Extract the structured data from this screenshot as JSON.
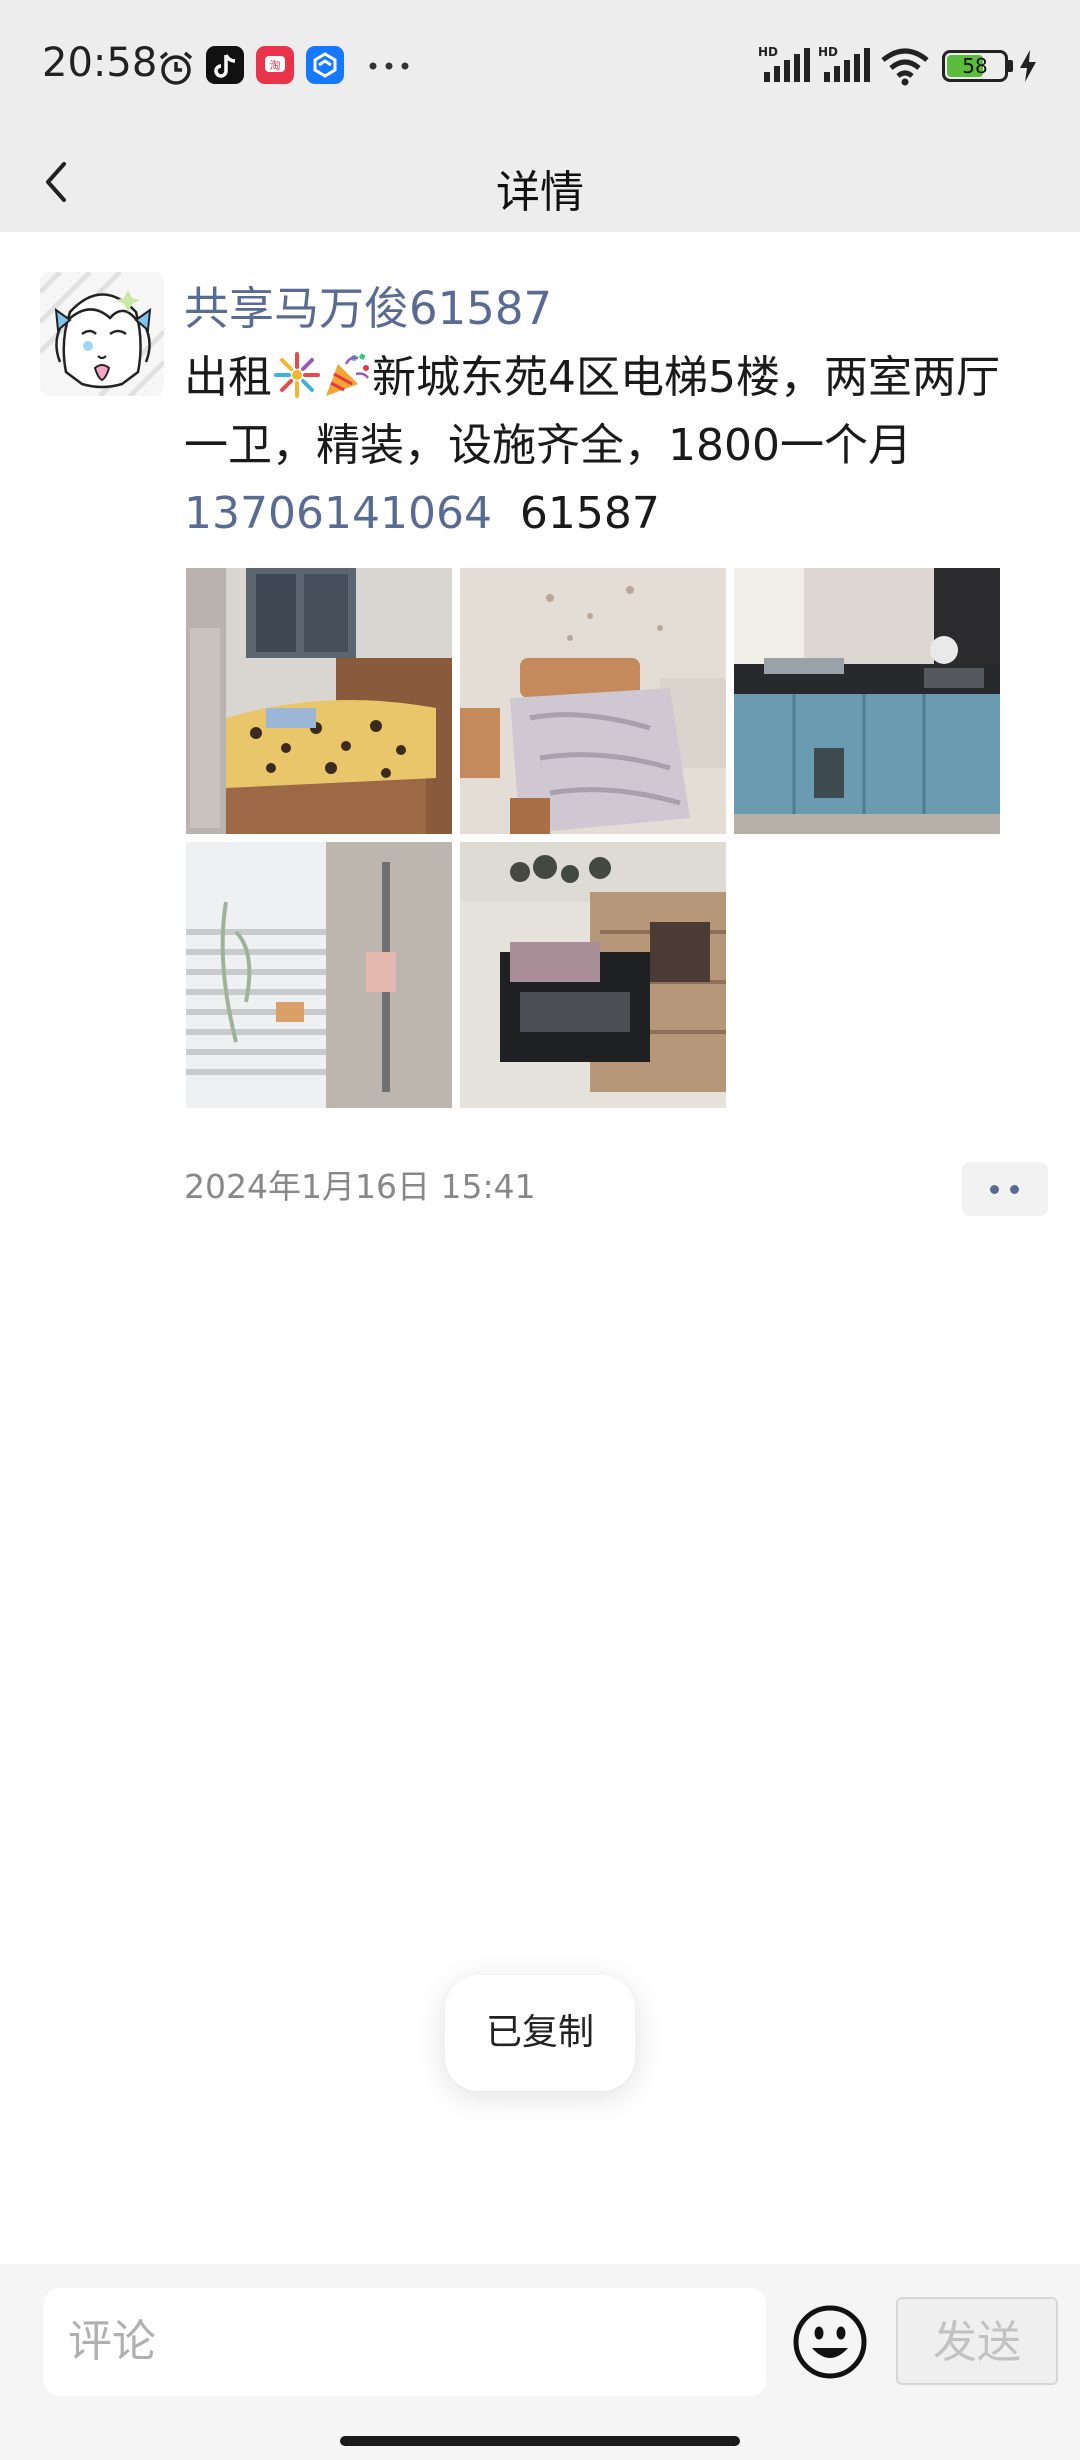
{
  "status_bar": {
    "time": "20:58",
    "battery": "58",
    "notification_icons": [
      "alarm-icon",
      "tiktok-icon",
      "taobao-icon",
      "blue-app-icon",
      "more-icon"
    ]
  },
  "header": {
    "title": "详情",
    "back_icon": "back-chevron-icon"
  },
  "post": {
    "username": "共享马万俊61587",
    "text_before_emoji": "出租",
    "text_after_emoji": "新城东苑4区电梯5楼，两室两厅一卫，精装，设施齐全，1800一个月",
    "phone": "13706141064",
    "code": "61587",
    "photos": [
      "bedroom-photo-1",
      "bedroom-photo-2",
      "kitchen-photo",
      "bathroom-photo",
      "living-room-photo"
    ],
    "timestamp": "2024年1月16日 15:41"
  },
  "toast": {
    "text": "已复制"
  },
  "footer": {
    "comment_placeholder": "评论",
    "send_label": "发送"
  }
}
